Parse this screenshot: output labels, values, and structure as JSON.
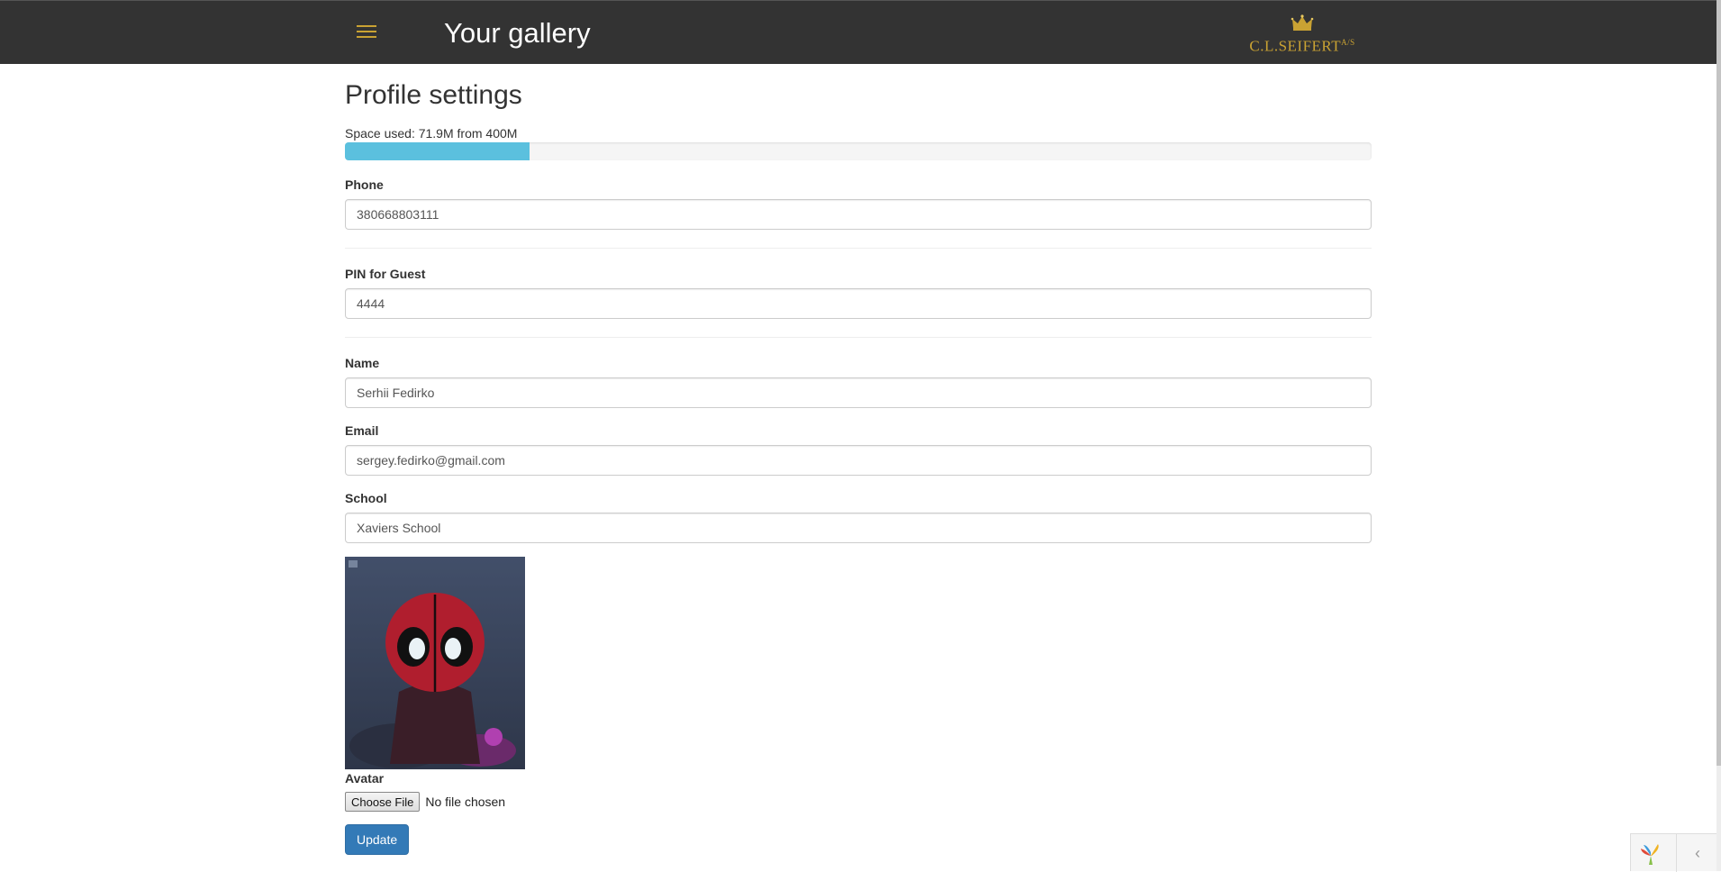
{
  "navbar": {
    "menu_icon": "hamburger-menu-icon",
    "title": "Your gallery",
    "logo_text": "C.L.SEIFERT",
    "logo_suffix": "A/S",
    "logo_icon": "crown-icon",
    "colors": {
      "background": "#333333",
      "accent": "#c9a233"
    }
  },
  "page": {
    "title": "Profile settings",
    "space_used_text": "Space used: 71.9M from 400M",
    "space_used_fraction": 0.18,
    "progress_color": "#5bc0de"
  },
  "form": {
    "phone": {
      "label": "Phone",
      "value": "380668803111"
    },
    "pin": {
      "label": "PIN for Guest",
      "value": "4444"
    },
    "name": {
      "label": "Name",
      "value": "Serhii Fedirko"
    },
    "email": {
      "label": "Email",
      "value": "sergey.fedirko@gmail.com"
    },
    "school": {
      "label": "School",
      "value": "Xaviers School"
    },
    "avatar": {
      "label": "Avatar",
      "choose_label": "Choose File",
      "file_status": "No file chosen"
    },
    "submit_label": "Update",
    "submit_color": "#337ab7"
  },
  "debug_toolbar": {
    "logo_icon": "yii-logo-icon",
    "toggle_icon": "chevron-left-icon"
  }
}
